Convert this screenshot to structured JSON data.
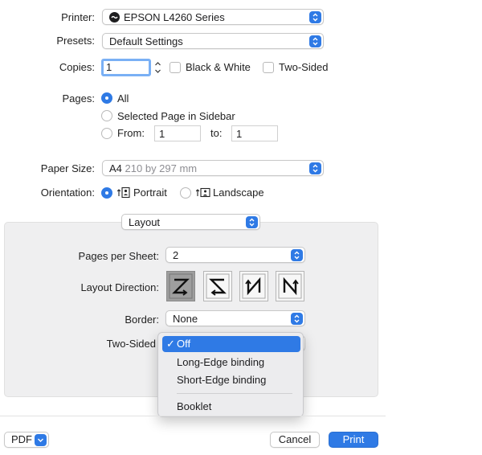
{
  "printer": {
    "label": "Printer:",
    "value": "EPSON L4260 Series",
    "icon": "printer-status-icon"
  },
  "presets": {
    "label": "Presets:",
    "value": "Default Settings"
  },
  "copies": {
    "label": "Copies:",
    "value": "1",
    "bw_label": "Black & White",
    "two_sided_label": "Two-Sided",
    "bw_checked": false,
    "two_sided_checked": false
  },
  "pages": {
    "label": "Pages:",
    "options": [
      "All",
      "Selected Page in Sidebar",
      "From:"
    ],
    "selected": "All",
    "from_value": "1",
    "to_label": "to:",
    "to_value": "1"
  },
  "paper_size": {
    "label": "Paper Size:",
    "value": "A4",
    "dims": "210 by 297 mm"
  },
  "orientation": {
    "label": "Orientation:",
    "portrait": "Portrait",
    "landscape": "Landscape",
    "selected": "Portrait"
  },
  "section_popup": {
    "value": "Layout"
  },
  "layout": {
    "pages_per_sheet_label": "Pages per Sheet:",
    "pages_per_sheet_value": "2",
    "layout_direction_label": "Layout Direction:",
    "directions": [
      "Z",
      "S",
      "N-reverse",
      "N"
    ],
    "selected_direction": 0,
    "border_label": "Border:",
    "border_value": "None",
    "two_sided_label": "Two-Sided"
  },
  "two_sided_menu": {
    "items": [
      "Off",
      "Long-Edge binding",
      "Short-Edge binding",
      "Booklet"
    ],
    "selected": "Off"
  },
  "footer": {
    "pdf_label": "PDF",
    "cancel_label": "Cancel",
    "print_label": "Print"
  },
  "colors": {
    "accent": "#2f7ae5",
    "panel": "#efeff0"
  }
}
